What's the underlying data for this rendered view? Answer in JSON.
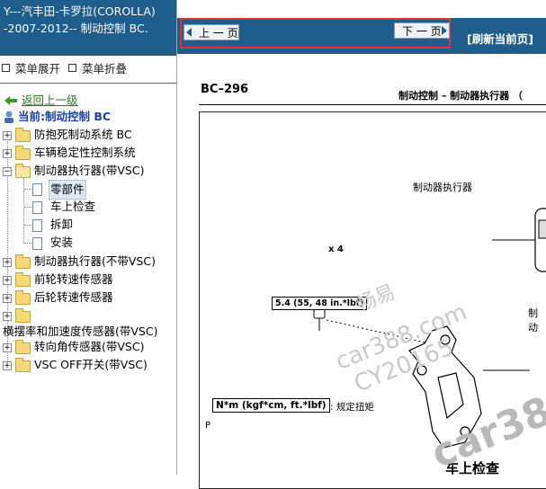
{
  "sidebar": {
    "title_line1": "Y---汽丰田-卡罗拉(COROLLA)",
    "title_line2": "-2007-2012-- 制动控制 BC.",
    "expand_label": "菜单展开",
    "collapse_label": "菜单折叠",
    "back_label": "返回上一级",
    "current_label": "当前:制动控制 BC",
    "tree": [
      {
        "label": "防抱死制动系统 BC",
        "kind": "folder",
        "state": "+"
      },
      {
        "label": "车辆稳定性控制系统",
        "kind": "folder",
        "state": "+"
      },
      {
        "label": "制动器执行器(带VSC)",
        "kind": "folder",
        "state": "-"
      },
      {
        "label": "零部件",
        "kind": "doc",
        "selected": true
      },
      {
        "label": "车上检查",
        "kind": "doc"
      },
      {
        "label": "拆卸",
        "kind": "doc"
      },
      {
        "label": "安装",
        "kind": "doc"
      },
      {
        "label": "制动器执行器(不带VSC)",
        "kind": "folder",
        "state": "+"
      },
      {
        "label": "前轮转速传感器",
        "kind": "folder",
        "state": "+"
      },
      {
        "label": "后轮转速传感器",
        "kind": "folder",
        "state": "+"
      },
      {
        "label": "",
        "kind": "folder",
        "state": "+"
      },
      {
        "label": "横摆率和加速度传感器(带VSC)",
        "kind": "text"
      },
      {
        "label": "转向角传感器(带VSC)",
        "kind": "folder",
        "state": "+"
      },
      {
        "label": "VSC OFF开关(带VSC)",
        "kind": "folder",
        "state": "+"
      }
    ]
  },
  "toolbar": {
    "prev_label": "上 一 页",
    "next_label": "下 一 页",
    "refresh_label": "[刷新当前页]"
  },
  "document": {
    "page_code": "BC–296",
    "header_title": "制动控制 – 制动器执行器 （",
    "actuator_label": "制动器执行器",
    "qty_label": "x 4",
    "torque_label": "5.4 (55, 48 in.*lbf)",
    "right_label": "制动",
    "unit_box": "N*m (kgf*cm, ft.*lbf)",
    "unit_desc": ": 规定扭矩",
    "corner_mark": "P",
    "section_title": "车上检查",
    "watermarks": [
      "畅易",
      "car388.com",
      "CY20165",
      "car38"
    ]
  }
}
